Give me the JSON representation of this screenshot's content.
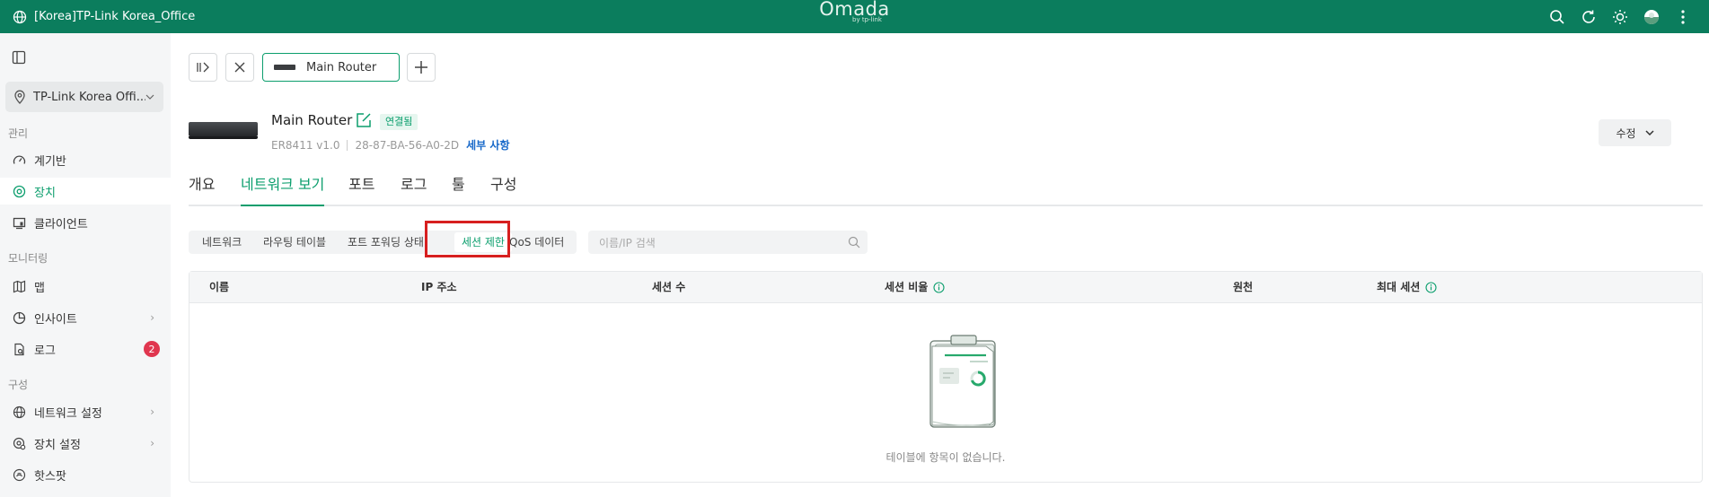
{
  "header": {
    "site_title": "[Korea]TP-Link Korea_Office",
    "brand": "Omada",
    "brand_sub": "by tp-link"
  },
  "sidebar": {
    "site_select": "TP-Link Korea Offi...",
    "sections": {
      "manage": "관리",
      "monitoring": "모니터링",
      "config": "구성"
    },
    "items": {
      "dashboard": "계기반",
      "devices": "장치",
      "clients": "클라이언트",
      "map": "맵",
      "insight": "인사이트",
      "log": "로그",
      "log_badge": "2",
      "network_settings": "네트워크 설정",
      "device_settings": "장치 설정",
      "hotspot": "핫스팟"
    }
  },
  "main": {
    "device_tab": "Main Router",
    "device": {
      "name": "Main Router",
      "status": "연결됨",
      "model": "ER8411 v1.0",
      "mac": "28-87-BA-56-A0-2D",
      "details_link": "세부 사항"
    },
    "edit_button": "수정",
    "tabs": [
      "개요",
      "네트워크 보기",
      "포트",
      "로그",
      "툴",
      "구성"
    ],
    "subtabs": [
      "네트워크",
      "라우팅 테이블",
      "포트 포워딩 상태",
      "세션 제한",
      "QoS 데이터"
    ],
    "search_placeholder": "이름/IP 검색",
    "table": {
      "columns": [
        "이름",
        "IP 주소",
        "세션 수",
        "세션 비율",
        "원천",
        "최대 세션"
      ],
      "empty_text": "테이블에 항목이 없습니다."
    }
  },
  "colors": {
    "header": "#0b7d5d",
    "accent": "#0b9e6d",
    "highlight": "#d71f1f"
  }
}
